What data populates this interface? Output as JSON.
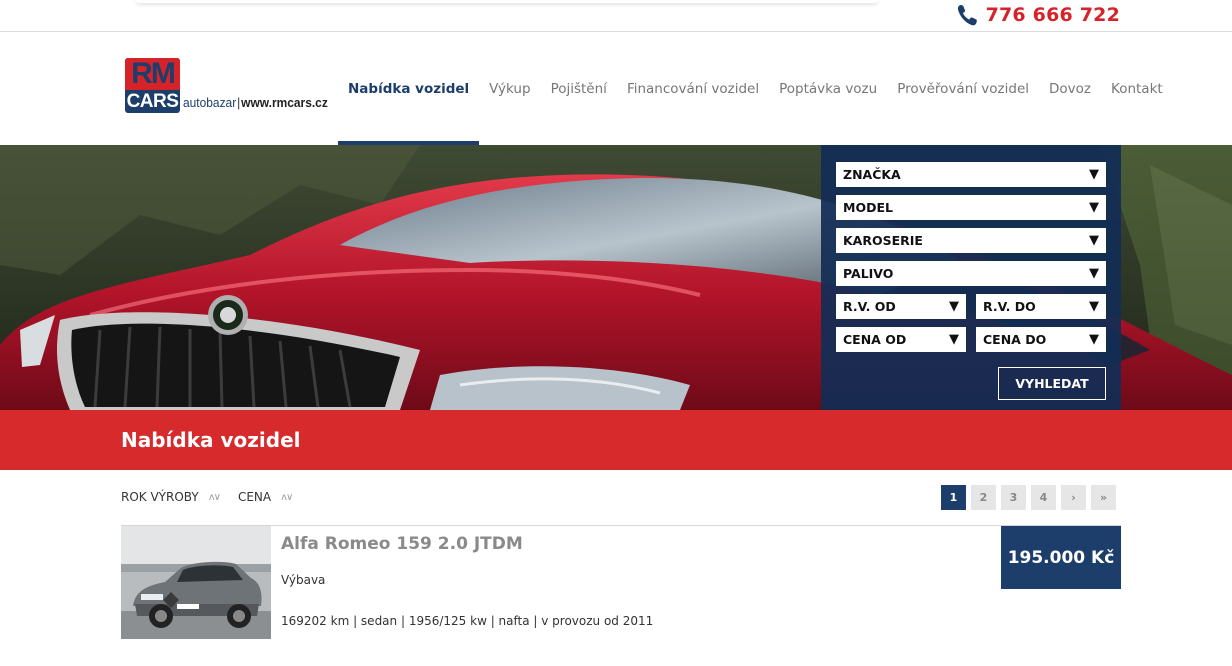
{
  "topbar": {
    "phone": "776 666 722",
    "phone_icon": "phone-icon",
    "phone_color": "#d6232a"
  },
  "logo": {
    "top": "RM",
    "bottom": "CARS",
    "tag_a": "autobazar",
    "tag_sep": "|",
    "tag_b": "www.rmcars.cz"
  },
  "nav": {
    "items": [
      {
        "label": "Nabídka vozidel",
        "active": true
      },
      {
        "label": "Výkup"
      },
      {
        "label": "Pojištění"
      },
      {
        "label": "Financování vozidel"
      },
      {
        "label": "Poptávka vozu"
      },
      {
        "label": "Prověřování vozidel"
      },
      {
        "label": "Dovoz"
      },
      {
        "label": "Kontakt"
      }
    ]
  },
  "search": {
    "znacka": "ZNAČKA",
    "model": "MODEL",
    "karoserie": "KAROSERIE",
    "palivo": "PALIVO",
    "rv_od": "R.V. OD",
    "rv_do": "R.V. DO",
    "cena_od": "CENA OD",
    "cena_do": "CENA DO",
    "arrow": "▼",
    "button": "VYHLEDAT"
  },
  "band": {
    "title": "Nabídka vozidel"
  },
  "sort": {
    "rok": "ROK VÝROBY",
    "cena": "CENA",
    "arrows": "ʌ∨"
  },
  "pagination": [
    "1",
    "2",
    "3",
    "4",
    "›",
    "»"
  ],
  "listing": {
    "title": "Alfa Romeo 159 2.0 JTDM",
    "equipment": "Výbava",
    "specs": "169202 km | sedan | 1956/125 kw | nafta | v provozu od 2011",
    "price": "195.000 Kč"
  },
  "colors": {
    "brand_navy": "#1d3e6b",
    "brand_red": "#d62a2c"
  }
}
